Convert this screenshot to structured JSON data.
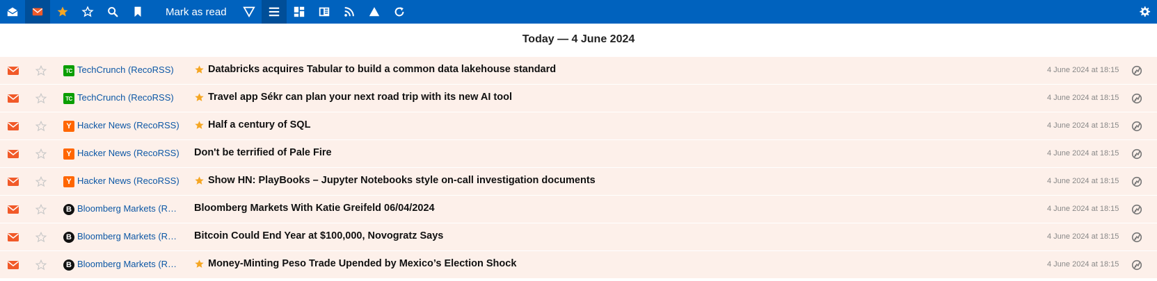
{
  "toolbar": {
    "mark_as_read_label": "Mark as read",
    "buttons": [
      "read-all-icon",
      "unread-icon",
      "starred-icon",
      "star-outline-icon",
      "search-icon",
      "bookmark-icon",
      "filter-icon",
      "normal-view-icon",
      "global-view-icon",
      "reader-view-icon",
      "rss-icon",
      "sort-icon",
      "refresh-icon",
      "settings-icon"
    ]
  },
  "day_header": "Today — 4 June 2024",
  "colors": {
    "toolbar_bg": "#0062be",
    "row_bg": "#fdf0ea",
    "feed_link": "#0c57a5",
    "mail_icon": "#f15a29",
    "hot_star": "#f5a623"
  },
  "articles": [
    {
      "feed": "TechCrunch (RecoRSS)",
      "favicon": "TC",
      "favicon_type": "tc",
      "hot": true,
      "title": "Databricks acquires Tabular to build a common data lakehouse standard",
      "date": "4 June 2024 at 18:15"
    },
    {
      "feed": "TechCrunch (RecoRSS)",
      "favicon": "TC",
      "favicon_type": "tc",
      "hot": true,
      "title": "Travel app Sékr can plan your next road trip with its new AI tool",
      "date": "4 June 2024 at 18:15"
    },
    {
      "feed": "Hacker News (RecoRSS)",
      "favicon": "Y",
      "favicon_type": "hn",
      "hot": true,
      "title": "Half a century of SQL",
      "date": "4 June 2024 at 18:15"
    },
    {
      "feed": "Hacker News (RecoRSS)",
      "favicon": "Y",
      "favicon_type": "hn",
      "hot": false,
      "title": "Don't be terrified of Pale Fire",
      "date": "4 June 2024 at 18:15"
    },
    {
      "feed": "Hacker News (RecoRSS)",
      "favicon": "Y",
      "favicon_type": "hn",
      "hot": true,
      "title": "Show HN: PlayBooks – Jupyter Notebooks style on-call investigation documents",
      "date": "4 June 2024 at 18:15"
    },
    {
      "feed": "Bloomberg Markets (RecoRSS)",
      "favicon": "B",
      "favicon_type": "bb",
      "hot": false,
      "title": "Bloomberg Markets With Katie Greifeld 06/04/2024",
      "date": "4 June 2024 at 18:15"
    },
    {
      "feed": "Bloomberg Markets (RecoRSS)",
      "favicon": "B",
      "favicon_type": "bb",
      "hot": false,
      "title": "Bitcoin Could End Year at $100,000, Novogratz Says",
      "date": "4 June 2024 at 18:15"
    },
    {
      "feed": "Bloomberg Markets (RecoRSS)",
      "favicon": "B",
      "favicon_type": "bb",
      "hot": true,
      "title": "Money-Minting Peso Trade Upended by Mexico’s Election Shock",
      "date": "4 June 2024 at 18:15"
    }
  ]
}
